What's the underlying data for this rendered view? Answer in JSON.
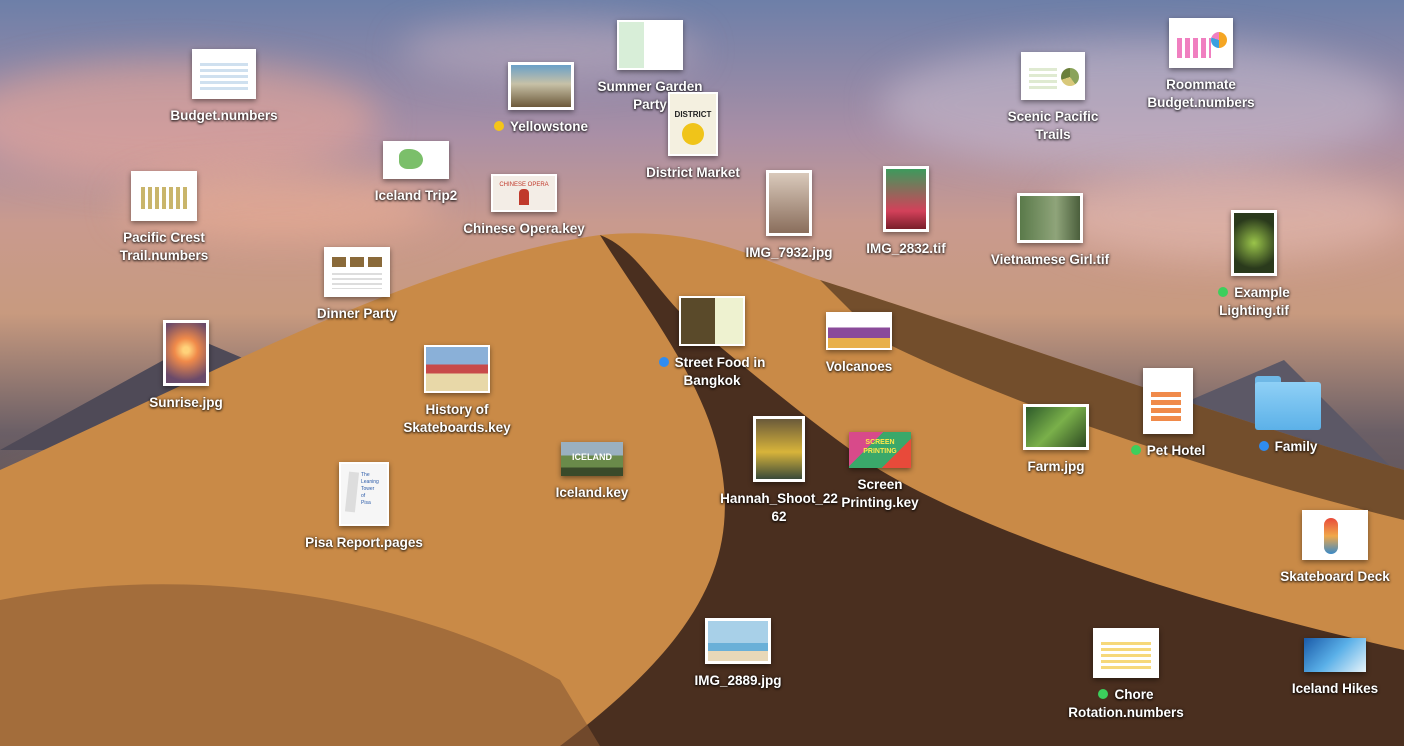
{
  "desktop": {
    "icons": [
      {
        "id": "budget",
        "label": "Budget.numbers",
        "tag": null
      },
      {
        "id": "yellowstone",
        "label": "Yellowstone",
        "tag": "#f5c518"
      },
      {
        "id": "summer",
        "label": "Summer Garden\nParty",
        "tag": null
      },
      {
        "id": "district",
        "label": "District Market",
        "tag": null
      },
      {
        "id": "scenic",
        "label": "Scenic Pacific\nTrails",
        "tag": null
      },
      {
        "id": "roommate",
        "label": "Roommate\nBudget.numbers",
        "tag": null
      },
      {
        "id": "iceland2",
        "label": "Iceland Trip2",
        "tag": null
      },
      {
        "id": "pacific",
        "label": "Pacific Crest\nTrail.numbers",
        "tag": null
      },
      {
        "id": "opera",
        "label": "Chinese Opera.key",
        "tag": null
      },
      {
        "id": "img7932",
        "label": "IMG_7932.jpg",
        "tag": null
      },
      {
        "id": "img2832",
        "label": "IMG_2832.tif",
        "tag": null
      },
      {
        "id": "vietnamese",
        "label": "Vietnamese Girl.tif",
        "tag": null
      },
      {
        "id": "lighting",
        "label": "Example\nLighting.tif",
        "tag": "#3ccf5c"
      },
      {
        "id": "dinner",
        "label": "Dinner Party",
        "tag": null
      },
      {
        "id": "streetfood",
        "label": "Street Food in\nBangkok",
        "tag": "#2f8cf0"
      },
      {
        "id": "volcanoes",
        "label": "Volcanoes",
        "tag": null
      },
      {
        "id": "sunrise",
        "label": "Sunrise.jpg",
        "tag": null
      },
      {
        "id": "skateboards",
        "label": "History of\nSkateboards.key",
        "tag": null
      },
      {
        "id": "pethotel",
        "label": "Pet Hotel",
        "tag": "#3ccf5c"
      },
      {
        "id": "family",
        "label": "Family",
        "tag": "#2f8cf0"
      },
      {
        "id": "farm",
        "label": "Farm.jpg",
        "tag": null
      },
      {
        "id": "icelandkey",
        "label": "Iceland.key",
        "tag": null
      },
      {
        "id": "hannah",
        "label": "Hannah_Shoot_22\n62",
        "tag": null
      },
      {
        "id": "screen",
        "label": "Screen\nPrinting.key",
        "tag": null
      },
      {
        "id": "pisa",
        "label": "Pisa Report.pages",
        "tag": null
      },
      {
        "id": "skatedeck",
        "label": "Skateboard Deck",
        "tag": null
      },
      {
        "id": "img2889",
        "label": "IMG_2889.jpg",
        "tag": null
      },
      {
        "id": "chore",
        "label": "Chore\nRotation.numbers",
        "tag": "#3ccf5c"
      },
      {
        "id": "icelandhikes",
        "label": "Iceland Hikes",
        "tag": null
      }
    ],
    "thumb_text": {
      "district": "DISTRICT",
      "iceland": "ICELAND",
      "screen": "SCREEN\nPRINTING",
      "pisa": "The\nLeaning\nTower\nof\nPisa",
      "opera": "CHINESE OPERA"
    }
  }
}
